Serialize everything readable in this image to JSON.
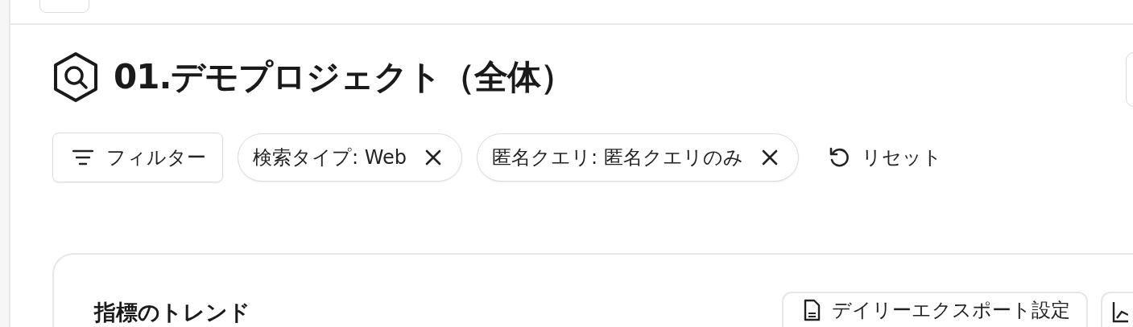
{
  "title": "01.デモプロジェクト（全体）",
  "filter_button": "フィルター",
  "chips": [
    {
      "label": "検索タイプ: Web"
    },
    {
      "label": "匿名クエリ: 匿名クエリのみ"
    }
  ],
  "reset_button": "リセット",
  "card": {
    "title": "指標のトレンド",
    "export_button": "デイリーエクスポート設定"
  }
}
